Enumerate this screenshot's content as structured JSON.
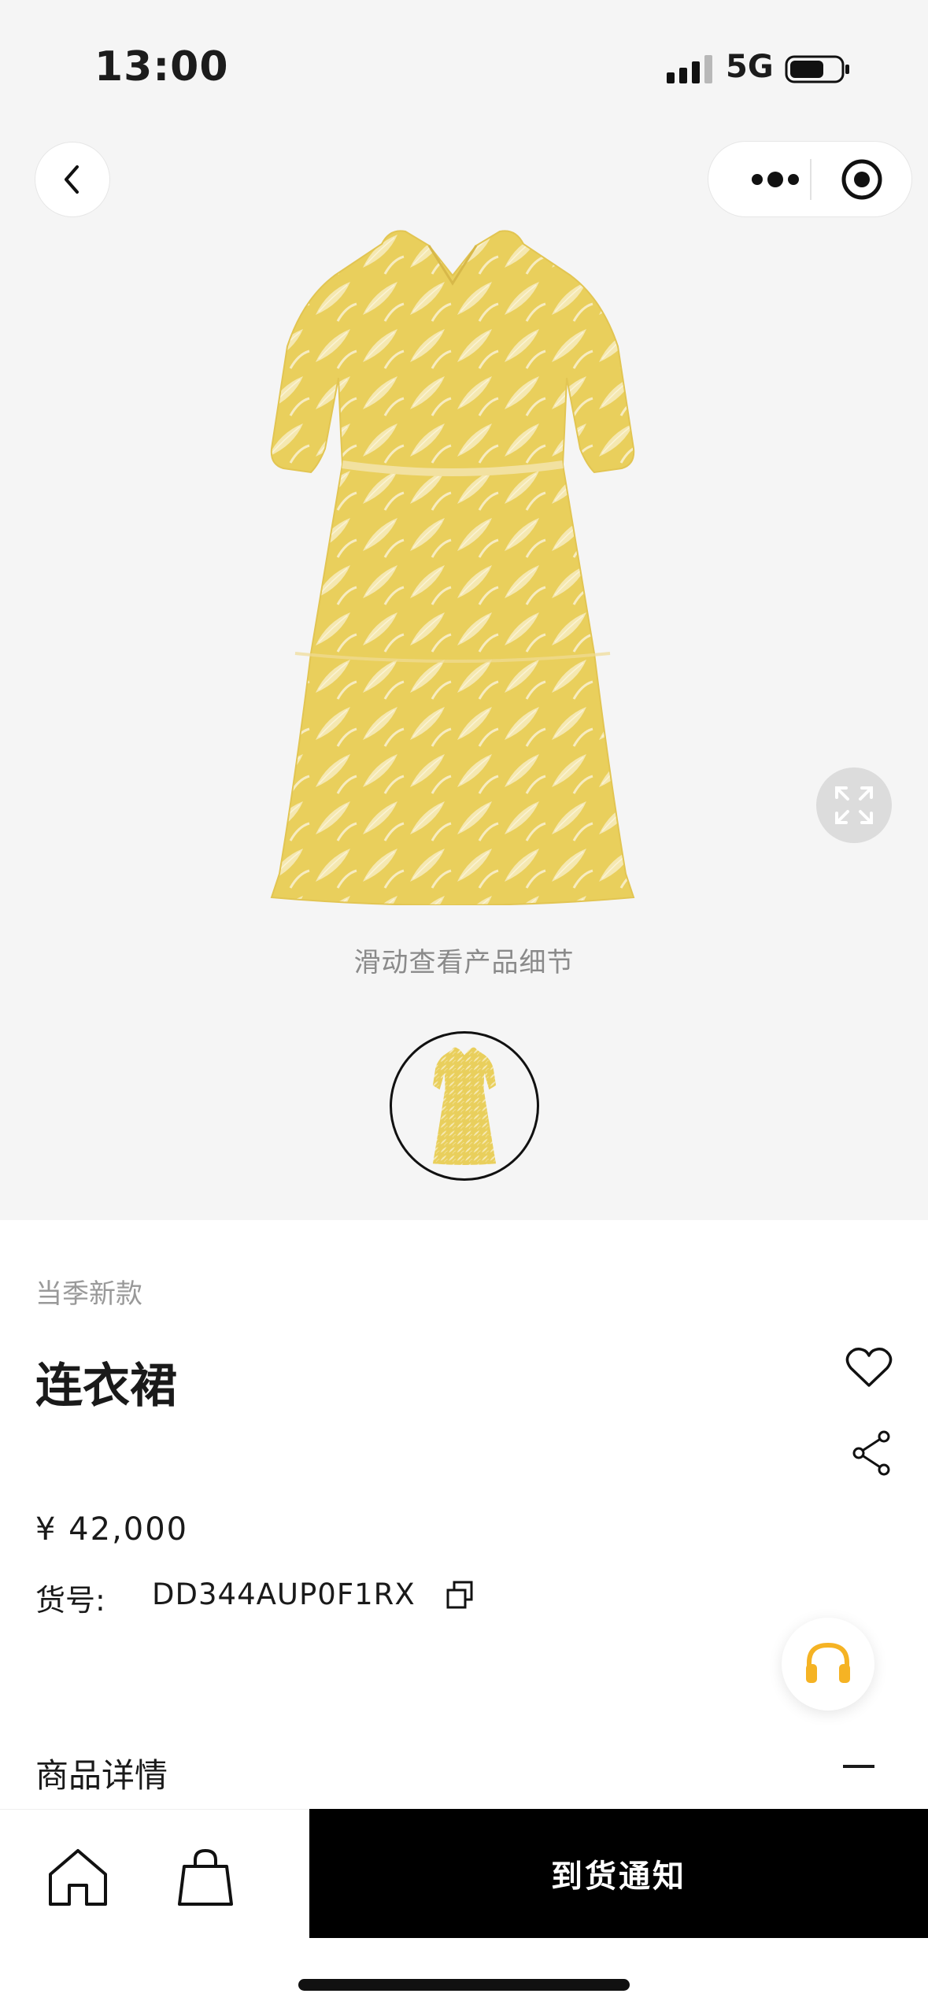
{
  "status_bar": {
    "time": "13:00",
    "network": "5G",
    "icons": [
      "signal-icon",
      "battery-icon"
    ]
  },
  "nav": {
    "icons": [
      "back-arrow-icon",
      "more-dots-icon",
      "target-icon"
    ]
  },
  "gallery": {
    "swipe_hint": "滑动查看产品细节",
    "thumbnail_count": 1,
    "icons": [
      "expand-icon"
    ],
    "colors": {
      "dress": "#e9cf5c",
      "pattern": "#f7ecc0",
      "background": "#f5f5f5"
    }
  },
  "product": {
    "season_tag": "当季新款",
    "name": "连衣裙",
    "price": "¥ 42,000",
    "sku_label": "货号:",
    "sku": "DD344AUP0F1RX",
    "icons": [
      "heart-icon",
      "share-icon",
      "copy-icon"
    ]
  },
  "service": {
    "icon": "headset-icon",
    "color": "#f5b324"
  },
  "details": {
    "label": "商品详情",
    "toggle": "—"
  },
  "bottom_bar": {
    "icons": [
      "home-icon",
      "bag-icon"
    ],
    "action": "到货通知",
    "action_bg": "#000000"
  }
}
